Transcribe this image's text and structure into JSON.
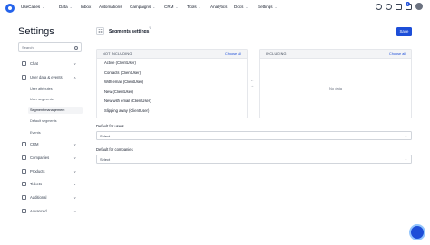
{
  "topnav": {
    "items": [
      {
        "label": "UseCases",
        "dropdown": true
      },
      {
        "label": "Data",
        "dropdown": true
      },
      {
        "label": "Inbox",
        "dropdown": false
      },
      {
        "label": "Automations",
        "dropdown": false
      },
      {
        "label": "Campaigns",
        "dropdown": true
      },
      {
        "label": "CRM",
        "dropdown": true
      },
      {
        "label": "Tools",
        "dropdown": true
      },
      {
        "label": "Analytics",
        "dropdown": false
      },
      {
        "label": "Docs",
        "dropdown": true
      },
      {
        "label": "Settings",
        "dropdown": true
      }
    ],
    "notification_count": "1",
    "icons": [
      "search-icon",
      "help-icon",
      "notes-icon",
      "bell-icon"
    ]
  },
  "sidebar": {
    "title": "Settings",
    "search_placeholder": "Search",
    "items": [
      {
        "label": "Chat",
        "icon": "chat-icon",
        "chevron": "∨"
      },
      {
        "label": "User data & events",
        "icon": "user-data-icon",
        "chevron": "∧"
      },
      {
        "label": "CRM",
        "icon": "crm-icon",
        "chevron": "∨"
      },
      {
        "label": "Companies",
        "icon": "companies-icon",
        "chevron": "∨"
      },
      {
        "label": "Products",
        "icon": "products-icon",
        "chevron": "∨"
      },
      {
        "label": "Tickets",
        "icon": "tickets-icon",
        "chevron": "∨"
      },
      {
        "label": "Additional",
        "icon": "additional-icon",
        "chevron": "∨"
      },
      {
        "label": "Advanced",
        "icon": "advanced-icon",
        "chevron": "∨"
      }
    ],
    "subitems": [
      {
        "label": "User attributes",
        "active": false
      },
      {
        "label": "User segments",
        "active": false
      },
      {
        "label": "Segment management",
        "active": true
      },
      {
        "label": "Default segments",
        "active": false
      },
      {
        "label": "Events",
        "active": false
      }
    ]
  },
  "main": {
    "title": "Segments settings",
    "save_label": "Save",
    "not_including": {
      "header": "NOT INCLUDING",
      "choose_all": "Choose all",
      "rows": [
        "Active (ClientUser)",
        "Contacts (ClientUser)",
        "With email (ClientUser)",
        "New (ClientUser)",
        "New with email (ClientUser)",
        "Slipping away (ClientUser)"
      ]
    },
    "including": {
      "header": "INCLUDING",
      "choose_all": "Choose all",
      "empty_text": "No data"
    },
    "default_users_label": "Default for users",
    "default_users_value": "Select",
    "default_companies_label": "Default for companies",
    "default_companies_value": "Select"
  },
  "colors": {
    "accent": "#1d4ed8",
    "panel_header_bg": "#f3f4f6"
  }
}
